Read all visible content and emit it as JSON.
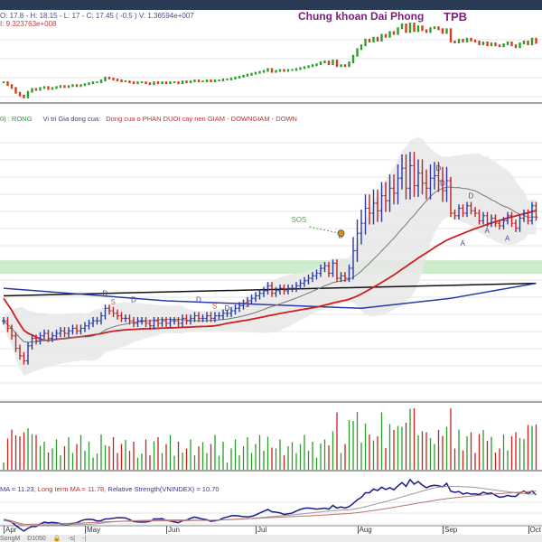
{
  "header": {
    "ohlc_text": "O: 17.8 - H: 18.15 - L: 17 - C: 17.45 ( -0.5 ) V: 1.36594e+007",
    "secondary_text": "I: 9.323763e+008",
    "brand": "Chung khoan Dai Phong",
    "ticker": "TPB"
  },
  "status_line": {
    "state": "0) : RONG",
    "label": "Vi tri Gia dong cua:",
    "value": "Dong cua o PHAN DUOI cay nen GIAM - DOWNGIAM - DOWN"
  },
  "rs_panel": {
    "ma_text": "MA = 11.23,",
    "long_ma_text": " Long term MA = 11.78,",
    "rs_text": " Relative Strength(VNINDEX) = 10.70"
  },
  "tabs": {
    "items": [
      "SongM",
      "D1050",
      "🔒",
      "-s|",
      "-|"
    ]
  },
  "colors": {
    "up": "#2aa02a",
    "down": "#d04020",
    "bar_up": "#2a3aa0",
    "bar_down": "#c02020",
    "ma_short": "#777777",
    "ma_mid": "#cc1f1f",
    "ma_long": "#2a3aa8",
    "trend": "#111111",
    "zone": "#bfe8bf"
  },
  "chart_data": {
    "type": "candlestick",
    "title": "Chung khoan Dai Phong - TPB",
    "months": [
      {
        "label": "Apr",
        "bar": 0
      },
      {
        "label": "May",
        "bar": 20
      },
      {
        "label": "Jun",
        "bar": 40
      },
      {
        "label": "Jul",
        "bar": 62
      },
      {
        "label": "Aug",
        "bar": 87
      },
      {
        "label": "Sep",
        "bar": 108
      },
      {
        "label": "Oct",
        "bar": 129
      }
    ],
    "close": [
      13.3,
      13.0,
      12.7,
      12.2,
      11.9,
      11.7,
      12.3,
      12.6,
      12.5,
      12.7,
      12.8,
      12.6,
      12.7,
      12.8,
      12.9,
      12.8,
      12.9,
      13.0,
      12.9,
      13.0,
      13.1,
      13.2,
      13.3,
      13.3,
      13.5,
      13.8,
      13.7,
      13.6,
      13.5,
      13.4,
      13.4,
      13.3,
      13.2,
      13.3,
      13.3,
      13.2,
      13.1,
      13.3,
      13.2,
      13.3,
      13.2,
      13.3,
      13.3,
      13.2,
      13.4,
      13.3,
      13.4,
      13.5,
      13.4,
      13.4,
      13.5,
      13.4,
      13.5,
      13.5,
      13.6,
      13.6,
      13.7,
      13.8,
      13.9,
      14.0,
      14.1,
      14.2,
      14.3,
      14.4,
      14.5,
      14.7,
      14.4,
      14.5,
      14.6,
      14.5,
      14.6,
      14.6,
      14.7,
      14.8,
      14.9,
      15.0,
      15.1,
      15.2,
      15.4,
      15.5,
      15.2,
      15.6,
      15.0,
      15.1,
      15.0,
      15.4,
      16.1,
      16.8,
      17.2,
      17.8,
      17.6,
      18.0,
      17.7,
      18.3,
      18.1,
      18.6,
      18.4,
      19.0,
      19.4,
      18.6,
      19.5,
      18.7,
      19.2,
      18.8,
      18.6,
      19.0,
      19.1,
      18.9,
      18.5,
      18.9,
      17.6,
      17.5,
      17.8,
      17.6,
      17.9,
      17.7,
      17.6,
      17.3,
      17.5,
      17.2,
      17.4,
      17.2,
      17.1,
      17.3,
      17.5,
      17.2,
      17.0,
      17.4,
      17.6,
      17.3,
      17.9,
      17.45
    ],
    "support_zone": [
      15.18,
      15.72
    ],
    "trend_line": [
      {
        "bar": 0,
        "price": 14.3
      },
      {
        "bar": 131,
        "price": 14.8
      }
    ],
    "long_ma_line": [
      {
        "bar": 0,
        "price": 14.6
      },
      {
        "bar": 40,
        "price": 14.1
      },
      {
        "bar": 88,
        "price": 13.8
      },
      {
        "bar": 110,
        "price": 14.2
      },
      {
        "bar": 131,
        "price": 14.8
      }
    ],
    "markers": [
      {
        "bar": 25,
        "type": "D",
        "price": 14.3
      },
      {
        "bar": 32,
        "type": "D",
        "price": 14.05
      },
      {
        "bar": 48,
        "type": "D",
        "price": 14.05
      },
      {
        "bar": 55,
        "type": "D",
        "price": 13.7
      },
      {
        "bar": 27,
        "type": "S",
        "price": 13.95
      },
      {
        "bar": 52,
        "type": "S",
        "price": 13.8
      },
      {
        "bar": 60,
        "type": "S",
        "price": 13.85
      },
      {
        "bar": 83,
        "type": "D",
        "price": 16.6
      },
      {
        "bar": 107,
        "type": "D",
        "price": 19.3
      },
      {
        "bar": 108,
        "type": "D",
        "price": 18.7
      },
      {
        "bar": 115,
        "type": "D",
        "price": 18.2
      },
      {
        "bar": 113,
        "type": "A",
        "price": 16.3
      },
      {
        "bar": 119,
        "type": "A",
        "price": 16.8
      },
      {
        "bar": 124,
        "type": "A",
        "price": 16.5
      }
    ],
    "annotation": {
      "label": "SOS",
      "bar": 83
    }
  }
}
